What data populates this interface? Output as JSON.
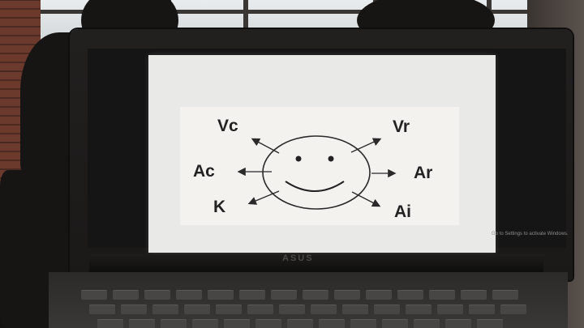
{
  "slide": {
    "labels": {
      "top_left": "Vc",
      "top_right": "Vr",
      "mid_left": "Ac",
      "mid_right": "Ar",
      "bottom_left": "K",
      "bottom_right": "Ai"
    },
    "watermark": "Go to Settings to activate Windows."
  },
  "laptop": {
    "brand": "ASUS"
  },
  "colors": {
    "slide_bg": "#e9e9e7",
    "ink": "#222222",
    "screen_bezel": "#1a1918"
  }
}
